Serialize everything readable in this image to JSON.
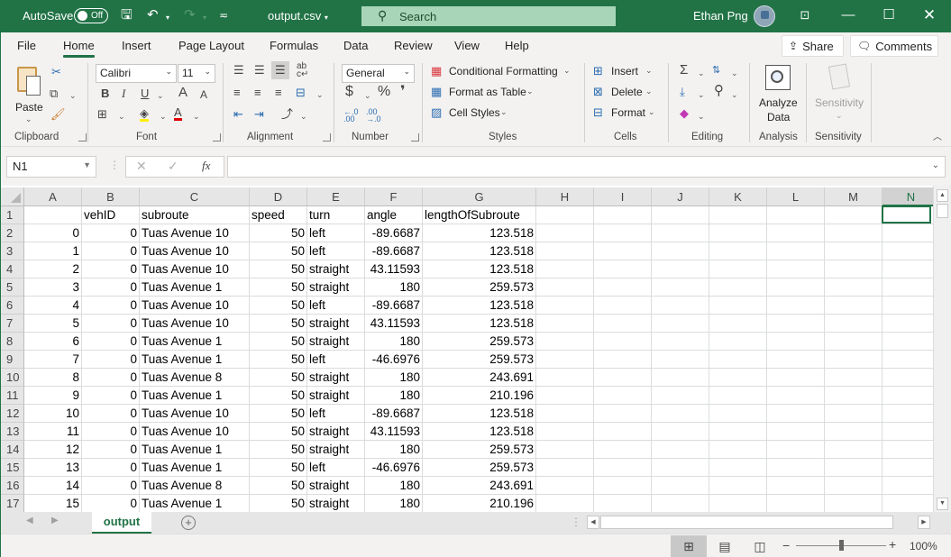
{
  "titlebar": {
    "autosave_label": "AutoSave",
    "autosave_state": "Off",
    "filename": "output.csv",
    "search_placeholder": "Search",
    "user_name": "Ethan Png"
  },
  "menu": {
    "tabs": [
      "File",
      "Home",
      "Insert",
      "Page Layout",
      "Formulas",
      "Data",
      "Review",
      "View",
      "Help"
    ],
    "active_tab": "Home",
    "share_label": "Share",
    "comments_label": "Comments"
  },
  "ribbon": {
    "clipboard": {
      "label": "Clipboard",
      "paste": "Paste"
    },
    "font": {
      "label": "Font",
      "font_name": "Calibri",
      "font_size": "11",
      "bold": "B",
      "italic": "I",
      "underline": "U",
      "grow": "A",
      "shrink": "A",
      "font_color": "A"
    },
    "alignment": {
      "label": "Alignment"
    },
    "number": {
      "label": "Number",
      "format": "General",
      "currency": "$",
      "percent": "%",
      "comma": "❜",
      "inc_decimal": "←.0 .00",
      "dec_decimal": ".00 →.0"
    },
    "styles": {
      "label": "Styles",
      "conditional": "Conditional Formatting",
      "format_table": "Format as Table",
      "cell_styles": "Cell Styles"
    },
    "cells": {
      "label": "Cells",
      "insert": "Insert",
      "delete": "Delete",
      "format": "Format"
    },
    "editing": {
      "label": "Editing"
    },
    "analysis": {
      "label": "Analysis",
      "analyze_line1": "Analyze",
      "analyze_line2": "Data"
    },
    "sensitivity": {
      "label": "Sensitivity",
      "button": "Sensitivity"
    }
  },
  "formula_bar": {
    "name_box": "N1",
    "fx": "fx",
    "value": ""
  },
  "grid": {
    "columns": [
      "A",
      "B",
      "C",
      "D",
      "E",
      "F",
      "G",
      "H",
      "I",
      "J",
      "K",
      "L",
      "M",
      "N"
    ],
    "selected_column": "N",
    "selected_cell": "N1",
    "rows": [
      {
        "n": "1",
        "A": "",
        "B": "vehID",
        "C": "subroute",
        "D": "speed",
        "E": "turn",
        "F": "angle",
        "G": "lengthOfSubroute"
      },
      {
        "n": "2",
        "A": "0",
        "B": "0",
        "C": "Tuas Avenue 10",
        "D": "50",
        "E": "left",
        "F": "-89.6687",
        "G": "123.518"
      },
      {
        "n": "3",
        "A": "1",
        "B": "0",
        "C": "Tuas Avenue 10",
        "D": "50",
        "E": "left",
        "F": "-89.6687",
        "G": "123.518"
      },
      {
        "n": "4",
        "A": "2",
        "B": "0",
        "C": "Tuas Avenue 10",
        "D": "50",
        "E": "straight",
        "F": "43.11593",
        "G": "123.518"
      },
      {
        "n": "5",
        "A": "3",
        "B": "0",
        "C": "Tuas Avenue 1",
        "D": "50",
        "E": "straight",
        "F": "180",
        "G": "259.573"
      },
      {
        "n": "6",
        "A": "4",
        "B": "0",
        "C": "Tuas Avenue 10",
        "D": "50",
        "E": "left",
        "F": "-89.6687",
        "G": "123.518"
      },
      {
        "n": "7",
        "A": "5",
        "B": "0",
        "C": "Tuas Avenue 10",
        "D": "50",
        "E": "straight",
        "F": "43.11593",
        "G": "123.518"
      },
      {
        "n": "8",
        "A": "6",
        "B": "0",
        "C": "Tuas Avenue 1",
        "D": "50",
        "E": "straight",
        "F": "180",
        "G": "259.573"
      },
      {
        "n": "9",
        "A": "7",
        "B": "0",
        "C": "Tuas Avenue 1",
        "D": "50",
        "E": "left",
        "F": "-46.6976",
        "G": "259.573"
      },
      {
        "n": "10",
        "A": "8",
        "B": "0",
        "C": "Tuas Avenue 8",
        "D": "50",
        "E": "straight",
        "F": "180",
        "G": "243.691"
      },
      {
        "n": "11",
        "A": "9",
        "B": "0",
        "C": "Tuas Avenue 1",
        "D": "50",
        "E": "straight",
        "F": "180",
        "G": "210.196"
      },
      {
        "n": "12",
        "A": "10",
        "B": "0",
        "C": "Tuas Avenue 10",
        "D": "50",
        "E": "left",
        "F": "-89.6687",
        "G": "123.518"
      },
      {
        "n": "13",
        "A": "11",
        "B": "0",
        "C": "Tuas Avenue 10",
        "D": "50",
        "E": "straight",
        "F": "43.11593",
        "G": "123.518"
      },
      {
        "n": "14",
        "A": "12",
        "B": "0",
        "C": "Tuas Avenue 1",
        "D": "50",
        "E": "straight",
        "F": "180",
        "G": "259.573"
      },
      {
        "n": "15",
        "A": "13",
        "B": "0",
        "C": "Tuas Avenue 1",
        "D": "50",
        "E": "left",
        "F": "-46.6976",
        "G": "259.573"
      },
      {
        "n": "16",
        "A": "14",
        "B": "0",
        "C": "Tuas Avenue 8",
        "D": "50",
        "E": "straight",
        "F": "180",
        "G": "243.691"
      },
      {
        "n": "17",
        "A": "15",
        "B": "0",
        "C": "Tuas Avenue 1",
        "D": "50",
        "E": "straight",
        "F": "180",
        "G": "210.196"
      }
    ]
  },
  "sheets": {
    "tabs": [
      "output"
    ],
    "active": "output"
  },
  "status": {
    "zoom": "100%",
    "zoom_percent": 100
  }
}
